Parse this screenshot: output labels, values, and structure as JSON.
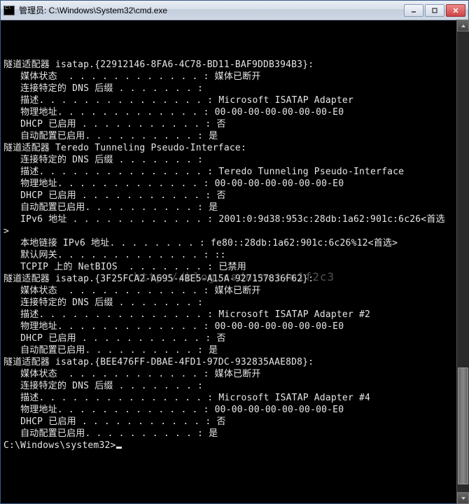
{
  "window": {
    "title": "管理员: C:\\Windows\\System32\\cmd.exe"
  },
  "adapters": [
    {
      "header": "隧道适配器 isatap.{22912146-8FA6-4C78-BD11-BAF9DDB394B3}:",
      "rows": [
        {
          "label": "媒体状态",
          "dots": "  . . . . . . . . . . . . :",
          "value": " 媒体已断开"
        },
        {
          "label": "连接特定的 DNS 后缀",
          "dots": " . . . . . . . :",
          "value": ""
        },
        {
          "label": "描述",
          "dots": ". . . . . . . . . . . . . . . :",
          "value": " Microsoft ISATAP Adapter"
        },
        {
          "label": "物理地址",
          "dots": ". . . . . . . . . . . . . :",
          "value": " 00-00-00-00-00-00-00-E0"
        },
        {
          "label": "DHCP 已启用",
          "dots": " . . . . . . . . . . . :",
          "value": " 否"
        },
        {
          "label": "自动配置已启用",
          "dots": ". . . . . . . . . . :",
          "value": " 是"
        }
      ]
    },
    {
      "header": "隧道适配器 Teredo Tunneling Pseudo-Interface:",
      "rows": [
        {
          "label": "连接特定的 DNS 后缀",
          "dots": " . . . . . . . :",
          "value": ""
        },
        {
          "label": "描述",
          "dots": ". . . . . . . . . . . . . . . :",
          "value": " Teredo Tunneling Pseudo-Interface"
        },
        {
          "label": "物理地址",
          "dots": ". . . . . . . . . . . . . :",
          "value": " 00-00-00-00-00-00-00-E0"
        },
        {
          "label": "DHCP 已启用",
          "dots": " . . . . . . . . . . . :",
          "value": " 否"
        },
        {
          "label": "自动配置已启用",
          "dots": ". . . . . . . . . . :",
          "value": " 是"
        },
        {
          "label": "IPv6 地址",
          "dots": " . . . . . . . . . . . . :",
          "value": " 2001:0:9d38:953c:28db:1a62:901c:6c26<首选",
          "wrap": ">"
        },
        {
          "label": "本地链接 IPv6 地址",
          "dots": ". . . . . . . . :",
          "value": " fe80::28db:1a62:901c:6c26%12<首选>"
        },
        {
          "label": "默认网关",
          "dots": ". . . . . . . . . . . . . :",
          "value": " ::"
        },
        {
          "label": "TCPIP 上的 NetBIOS",
          "dots": "  . . . . . . . :",
          "value": " 已禁用"
        }
      ]
    },
    {
      "header": "隧道适配器 isatap.{3F25FCA2-A695-4BE5-A15A-927157836F62}:",
      "rows": [
        {
          "label": "媒体状态",
          "dots": "  . . . . . . . . . . . . :",
          "value": " 媒体已断开"
        },
        {
          "label": "连接特定的 DNS 后缀",
          "dots": " . . . . . . . :",
          "value": ""
        },
        {
          "label": "描述",
          "dots": ". . . . . . . . . . . . . . . :",
          "value": " Microsoft ISATAP Adapter #2"
        },
        {
          "label": "物理地址",
          "dots": ". . . . . . . . . . . . . :",
          "value": " 00-00-00-00-00-00-00-E0"
        },
        {
          "label": "DHCP 已启用",
          "dots": " . . . . . . . . . . . :",
          "value": " 否"
        },
        {
          "label": "自动配置已启用",
          "dots": ". . . . . . . . . . :",
          "value": " 是"
        }
      ]
    },
    {
      "header": "隧道适配器 isatap.{BEE476FF-DBAE-4FD1-97DC-932835AAE8D8}:",
      "rows": [
        {
          "label": "媒体状态",
          "dots": "  . . . . . . . . . . . . :",
          "value": " 媒体已断开"
        },
        {
          "label": "连接特定的 DNS 后缀",
          "dots": " . . . . . . . :",
          "value": ""
        },
        {
          "label": "描述",
          "dots": ". . . . . . . . . . . . . . . :",
          "value": " Microsoft ISATAP Adapter #4"
        },
        {
          "label": "物理地址",
          "dots": ". . . . . . . . . . . . . :",
          "value": " 00-00-00-00-00-00-00-E0"
        },
        {
          "label": "DHCP 已启用",
          "dots": " . . . . . . . . . . . :",
          "value": " 否"
        },
        {
          "label": "自动配置已启用",
          "dots": ". . . . . . . . . . :",
          "value": " 是"
        }
      ]
    }
  ],
  "prompt": "C:\\Windows\\system32>",
  "watermark": "http://blog.csdn.net/m1f2c3",
  "scrollbar": {
    "thumb_top_pct": 73,
    "thumb_height_pct": 25
  }
}
